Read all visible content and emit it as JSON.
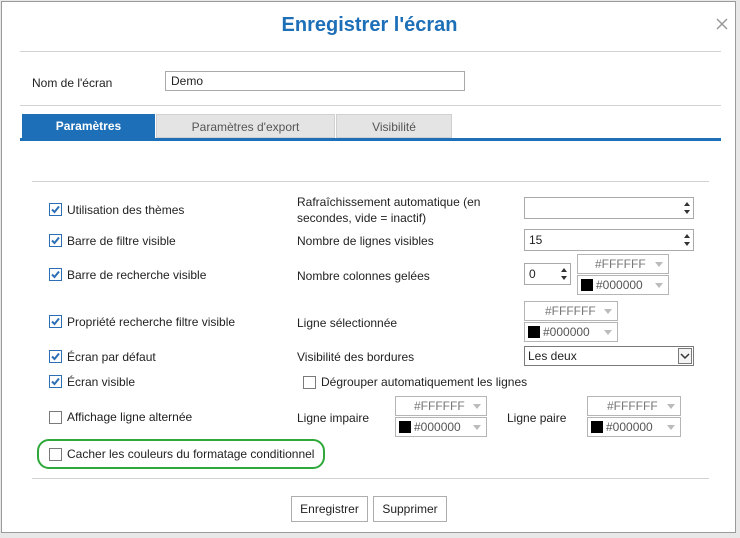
{
  "dialog": {
    "title": "Enregistrer l'écran"
  },
  "name_field": {
    "label": "Nom de l'écran",
    "value": "Demo"
  },
  "tabs": [
    {
      "label": "Paramètres",
      "active": true
    },
    {
      "label": "Paramètres d'export",
      "active": false
    },
    {
      "label": "Visibilité",
      "active": false
    }
  ],
  "checkboxes": {
    "themes": {
      "label": "Utilisation des thèmes",
      "checked": true
    },
    "filter_bar": {
      "label": "Barre de filtre visible",
      "checked": true
    },
    "search_bar": {
      "label": "Barre de recherche visible",
      "checked": true
    },
    "search_filter_prop": {
      "label": "Propriété recherche filtre visible",
      "checked": true
    },
    "default_screen": {
      "label": "Écran par défaut",
      "checked": true
    },
    "visible_screen": {
      "label": "Écran visible",
      "checked": true
    },
    "alt_rows": {
      "label": "Affichage ligne alternée",
      "checked": false
    },
    "hide_cond_colors": {
      "label": "Cacher les couleurs du formatage conditionnel",
      "checked": false
    },
    "ungroup_rows": {
      "label": "Dégrouper automatiquement les lignes",
      "checked": false
    }
  },
  "right": {
    "auto_refresh": {
      "label_line1": "Rafraîchissement automatique (en",
      "label_line2": "secondes, vide = inactif)",
      "value": ""
    },
    "visible_rows": {
      "label": "Nombre de lignes visibles",
      "value": "15"
    },
    "frozen_cols": {
      "label": "Nombre colonnes gelées",
      "value": "0",
      "bg": "#FFFFFF",
      "fg": "#000000"
    },
    "selected_row": {
      "label": "Ligne sélectionnée",
      "bg": "#FFFFFF",
      "fg": "#000000"
    },
    "borders": {
      "label": "Visibilité des bordures",
      "value": "Les deux"
    },
    "odd_row": {
      "label": "Ligne impaire",
      "bg": "#FFFFFF",
      "fg": "#000000"
    },
    "even_row": {
      "label": "Ligne paire",
      "bg": "#FFFFFF",
      "fg": "#000000"
    }
  },
  "buttons": {
    "save": "Enregistrer",
    "delete": "Supprimer"
  },
  "colors": {
    "accent": "#1d6fb8",
    "highlight": "#2fa83a",
    "check": "#2c6fb5"
  }
}
